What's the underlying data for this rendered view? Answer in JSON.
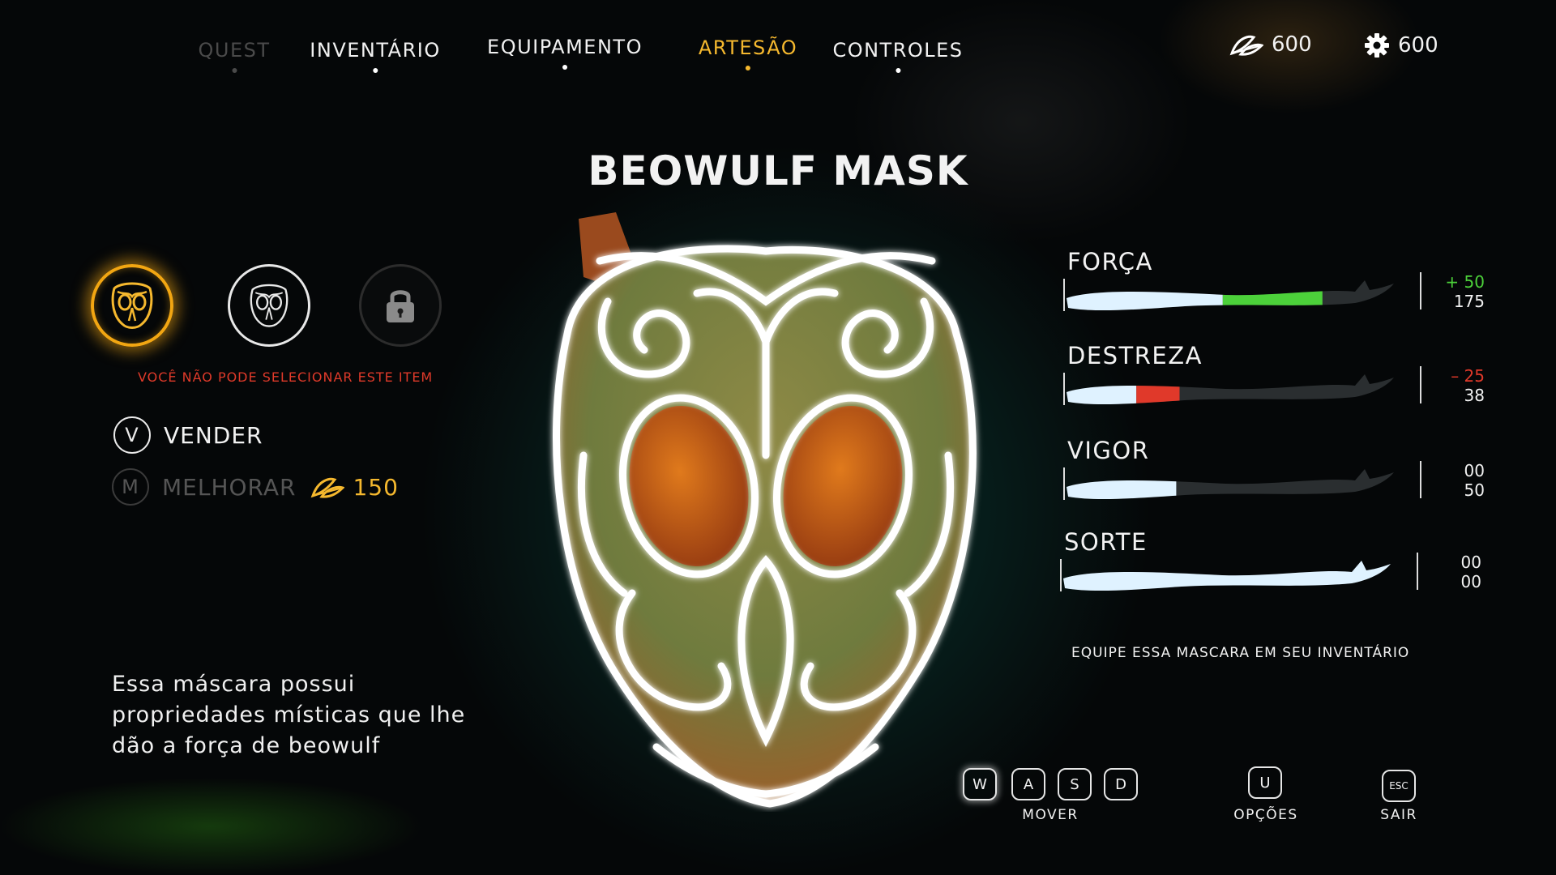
{
  "nav": {
    "tabs": [
      {
        "label": "QUEST",
        "state": "disabled"
      },
      {
        "label": "INVENTÁRIO",
        "state": "normal"
      },
      {
        "label": "EQUIPAMENTO",
        "state": "normal"
      },
      {
        "label": "ARTESÃO",
        "state": "active"
      },
      {
        "label": "CONTROLES",
        "state": "normal"
      }
    ],
    "currency_leaves": "600",
    "currency_gears": "600"
  },
  "item": {
    "title": "BEOWULF MASK",
    "warning": "VOCÊ NÃO PODE SELECIONAR ESTE ITEM",
    "description": "Essa máscara possui propriedades místicas que lhe dão a força de beowulf"
  },
  "actions": {
    "sell": {
      "key": "V",
      "label": "VENDER"
    },
    "upgrade": {
      "key": "M",
      "label": "MELHORAR",
      "cost": "150"
    }
  },
  "stats": [
    {
      "label": "FORÇA",
      "delta": "+ 50",
      "value": "175",
      "delta_type": "positive",
      "base_fraction": 0.48,
      "delta_fraction": 0.3
    },
    {
      "label": "DESTREZA",
      "delta": "– 25",
      "value": "38",
      "delta_type": "negative",
      "base_fraction": 0.22,
      "delta_fraction": 0.13
    },
    {
      "label": "VIGOR",
      "delta": "00",
      "value": "50",
      "delta_type": "none",
      "base_fraction": 0.34,
      "delta_fraction": 0
    },
    {
      "label": "SORTE",
      "delta": "00",
      "value": "00",
      "delta_type": "none",
      "base_fraction": 1.0,
      "delta_fraction": 0
    }
  ],
  "equip_note": "EQUIPE ESSA MASCARA EM SEU INVENTÁRIO",
  "controls": {
    "move_keys": [
      "W",
      "A",
      "S",
      "D"
    ],
    "move_label": "MOVER",
    "options_key": "U",
    "options_label": "OPÇÕES",
    "exit_key": "ESC",
    "exit_label": "SAIR"
  },
  "colors": {
    "accent": "#f5b82e",
    "positive": "#4cd13a",
    "negative": "#e0392a",
    "bar": "#dff2ff"
  },
  "icons": {
    "currency_leaves": "leaves-icon",
    "currency_gears": "gear-icon",
    "slot_selected": "owl-mask-icon",
    "slot_normal": "owl-mask-icon",
    "slot_locked": "lock-icon"
  }
}
